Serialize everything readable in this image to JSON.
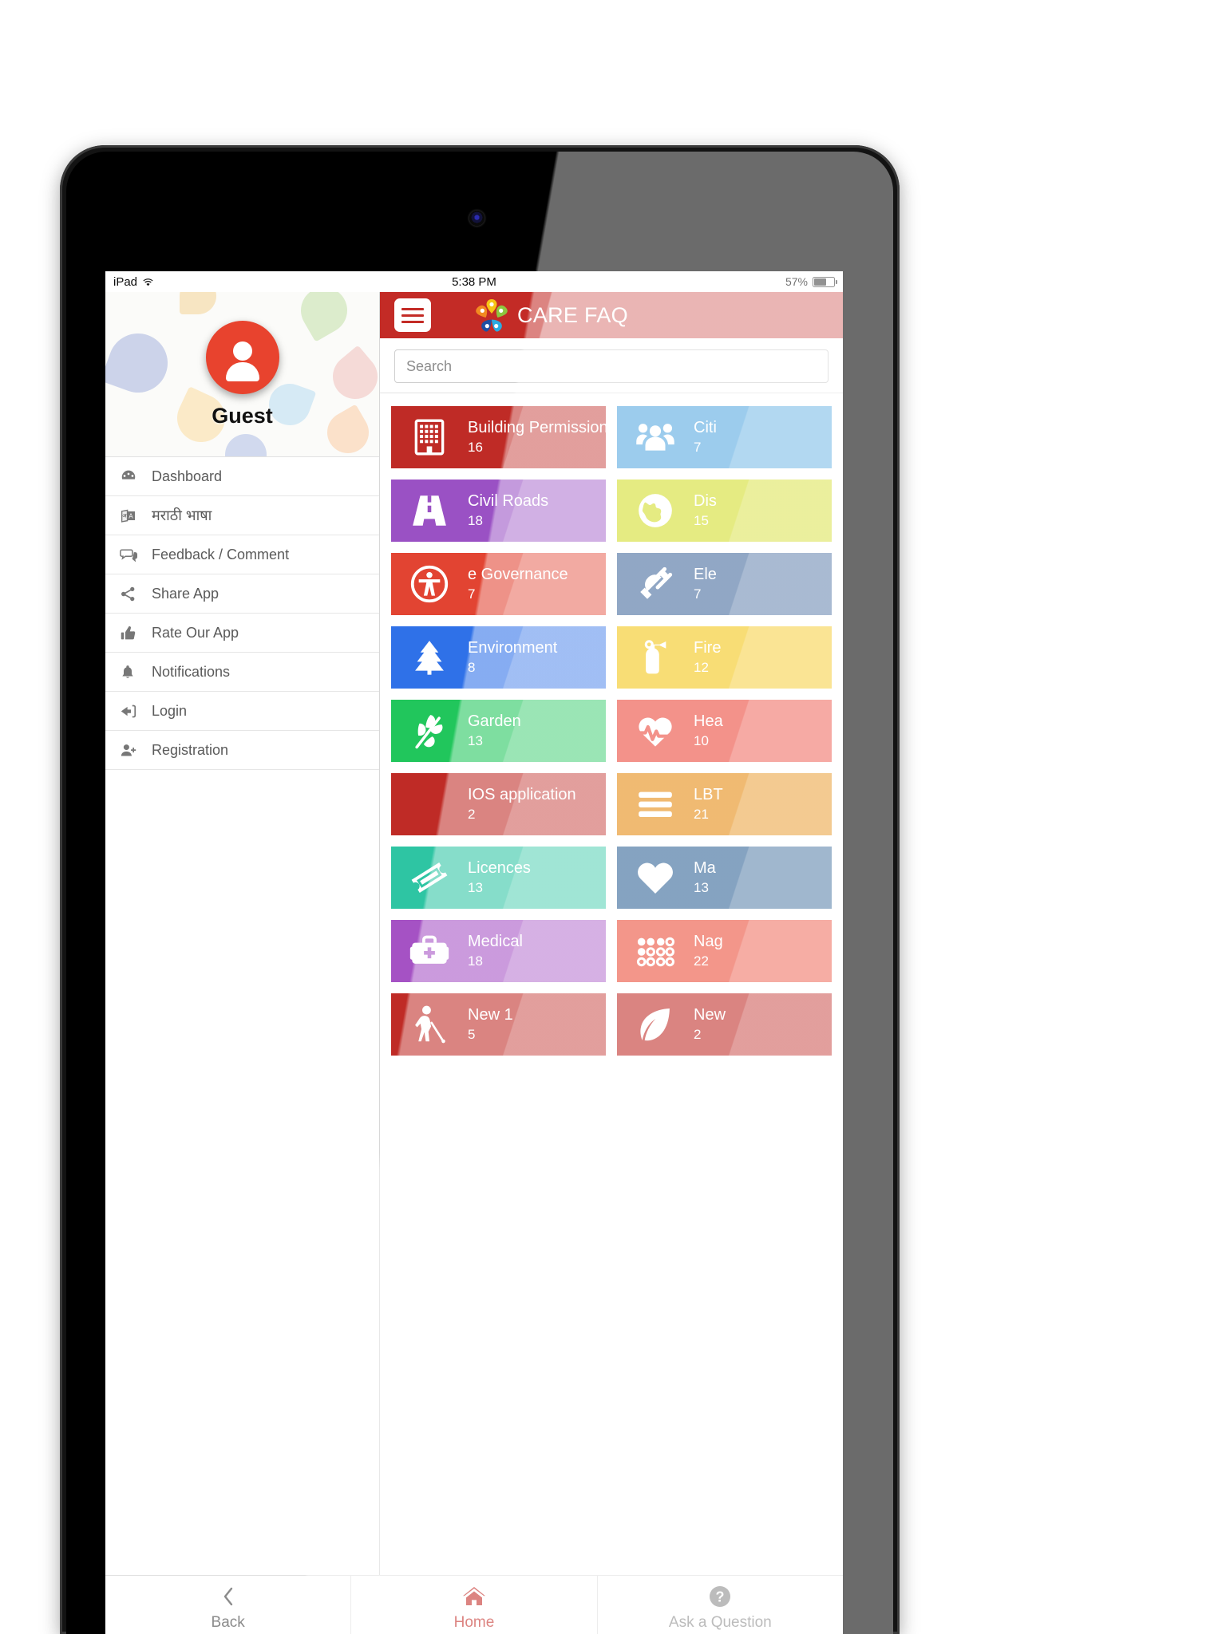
{
  "status_bar": {
    "device": "iPad",
    "wifi_icon": "wifi-icon",
    "time": "5:38 PM",
    "battery_percent": "57%",
    "battery_icon": "battery-icon"
  },
  "sidebar": {
    "profile": {
      "name": "Guest",
      "avatar_icon": "user-avatar-icon"
    },
    "items": [
      {
        "label": "Dashboard",
        "icon": "dashboard-icon"
      },
      {
        "label": "मराठी भाषा",
        "icon": "translate-icon"
      },
      {
        "label": "Feedback / Comment",
        "icon": "comment-icon"
      },
      {
        "label": "Share App",
        "icon": "share-icon"
      },
      {
        "label": "Rate Our App",
        "icon": "thumbs-up-icon"
      },
      {
        "label": "Notifications",
        "icon": "bell-icon"
      },
      {
        "label": "Login",
        "icon": "login-icon"
      },
      {
        "label": "Registration",
        "icon": "user-add-icon"
      }
    ]
  },
  "appbar": {
    "menu_icon": "hamburger-menu-icon",
    "logo_icon": "care-flower-logo-icon",
    "title": "CARE FAQ",
    "background_color": "#c32b26"
  },
  "search": {
    "placeholder": "Search",
    "value": ""
  },
  "tiles": [
    {
      "title": "Building Permission",
      "count": "16",
      "color": "#bf2b26",
      "icon": "building-icon"
    },
    {
      "title": "Citi",
      "count": "7",
      "color": "#55a8e0",
      "icon": "citizens-group-icon"
    },
    {
      "title": "Civil Roads",
      "count": "18",
      "color": "#9a51c4",
      "icon": "road-icon"
    },
    {
      "title": "Dis",
      "count": "15",
      "color": "#d3dd28",
      "icon": "globe-icon"
    },
    {
      "title": "e Governance",
      "count": "7",
      "color": "#e24432",
      "icon": "accessibility-icon"
    },
    {
      "title": "Ele",
      "count": "7",
      "color": "#41689b",
      "icon": "power-plug-icon"
    },
    {
      "title": "Environment",
      "count": "8",
      "color": "#2f71e8",
      "icon": "tree-icon"
    },
    {
      "title": "Fire",
      "count": "12",
      "color": "#f3c412",
      "icon": "fire-extinguisher-icon"
    },
    {
      "title": "Garden",
      "count": "13",
      "color": "#21c65c",
      "icon": "leaf-branch-icon"
    },
    {
      "title": "Hea",
      "count": "10",
      "color": "#eb4436",
      "icon": "heartbeat-icon"
    },
    {
      "title": "IOS application",
      "count": "2",
      "color": "#bf2b26",
      "icon": ""
    },
    {
      "title": "LBT",
      "count": "21",
      "color": "#e5890c",
      "icon": "list-bars-icon"
    },
    {
      "title": "Licences",
      "count": "13",
      "color": "#2ec5a3",
      "icon": "ticket-icon"
    },
    {
      "title": "Ma",
      "count": "13",
      "color": "#2d6094",
      "icon": "heart-icon"
    },
    {
      "title": "Medical",
      "count": "18",
      "color": "#a552c4",
      "icon": "medical-kit-icon"
    },
    {
      "title": "Nag",
      "count": "22",
      "color": "#ea4a36",
      "icon": "braille-dots-icon"
    },
    {
      "title": "New 1",
      "count": "5",
      "color": "#bf2b26",
      "icon": "blind-person-icon"
    },
    {
      "title": "New",
      "count": "2",
      "color": "#bf2b26",
      "icon": "leaf-icon"
    }
  ],
  "bottom_nav": [
    {
      "label": "Back",
      "icon": "chevron-left-icon",
      "active": false
    },
    {
      "label": "Home",
      "icon": "home-icon",
      "active": true
    },
    {
      "label": "Ask a Question",
      "icon": "question-circle-icon",
      "active": false
    }
  ]
}
